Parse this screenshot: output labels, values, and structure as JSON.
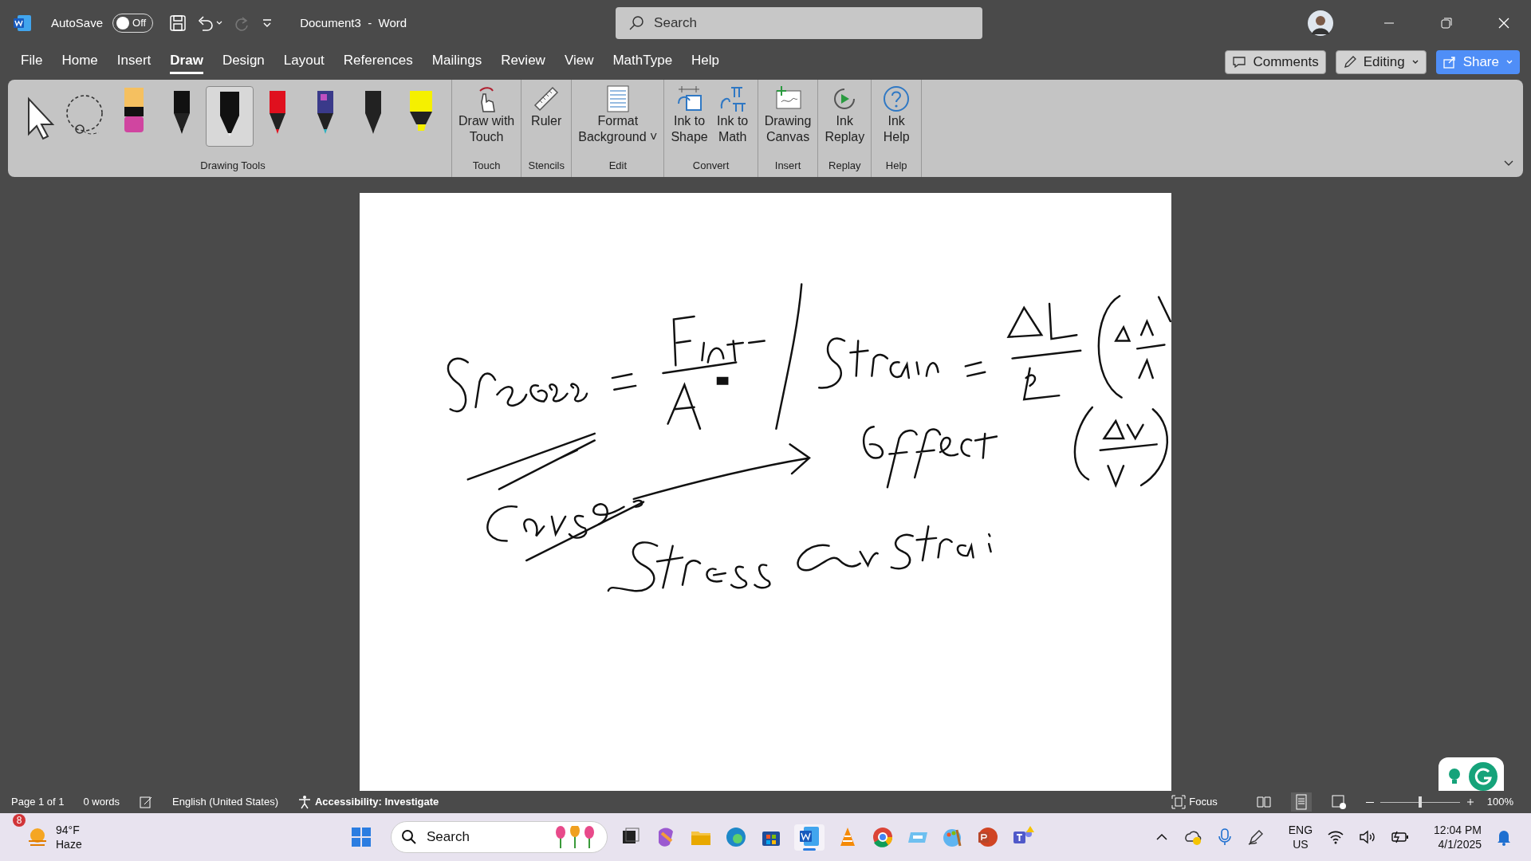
{
  "title_bar": {
    "autosave_label": "AutoSave",
    "autosave_state": "Off",
    "autosave_on": false,
    "document_title": "Document3  -  Word",
    "search_placeholder": "Search"
  },
  "menu_tabs": [
    {
      "label": "File",
      "selected": false
    },
    {
      "label": "Home",
      "selected": false
    },
    {
      "label": "Insert",
      "selected": false
    },
    {
      "label": "Draw",
      "selected": true
    },
    {
      "label": "Design",
      "selected": false
    },
    {
      "label": "Layout",
      "selected": false
    },
    {
      "label": "References",
      "selected": false
    },
    {
      "label": "Mailings",
      "selected": false
    },
    {
      "label": "Review",
      "selected": false
    },
    {
      "label": "View",
      "selected": false
    },
    {
      "label": "MathType",
      "selected": false
    },
    {
      "label": "Help",
      "selected": false
    }
  ],
  "header_buttons": {
    "comments": "Comments",
    "editing": "Editing",
    "share": "Share"
  },
  "drawing_tools": {
    "label": "Drawing Tools",
    "pens": [
      {
        "kind": "pen",
        "color": "#111111",
        "selected": false
      },
      {
        "kind": "pencil",
        "color": "#111111",
        "selected": true
      },
      {
        "kind": "pen",
        "color": "#e0101e",
        "selected": false
      },
      {
        "kind": "galaxy",
        "color": "#3a3a8a",
        "selected": false
      },
      {
        "kind": "pen",
        "color": "#222222",
        "selected": false
      },
      {
        "kind": "highlighter",
        "color": "#f5f000",
        "selected": false
      }
    ]
  },
  "ribbon_groups": [
    {
      "label": "Touch",
      "buttons": [
        {
          "lines": [
            "Draw with",
            "Touch"
          ]
        }
      ]
    },
    {
      "label": "Stencils",
      "buttons": [
        {
          "lines": [
            "Ruler"
          ]
        }
      ]
    },
    {
      "label": "Edit",
      "buttons": [
        {
          "lines": [
            "Format",
            "Background ˅"
          ]
        }
      ]
    },
    {
      "label": "Convert",
      "buttons": [
        {
          "lines": [
            "Ink to",
            "Shape"
          ]
        },
        {
          "lines": [
            "Ink to",
            "Math"
          ]
        }
      ]
    },
    {
      "label": "Insert",
      "buttons": [
        {
          "lines": [
            "Drawing",
            "Canvas"
          ]
        }
      ]
    },
    {
      "label": "Replay",
      "buttons": [
        {
          "lines": [
            "Ink",
            "Replay"
          ]
        }
      ]
    },
    {
      "label": "Help",
      "buttons": [
        {
          "lines": [
            "Ink",
            "Help"
          ]
        }
      ]
    }
  ],
  "status_bar": {
    "page": "Page 1 of 1",
    "words": "0 words",
    "language": "English (United States)",
    "accessibility": "Accessibility: Investigate",
    "focus": "Focus",
    "zoom": "100%",
    "zoom_slider": {
      "level": 0.5
    }
  },
  "taskbar": {
    "weather_badge": "8",
    "temperature": "94°F",
    "condition": "Haze",
    "search": "Search",
    "language": "ENG",
    "region": "US",
    "time": "12:04 PM",
    "date": "4/1/2025"
  }
}
